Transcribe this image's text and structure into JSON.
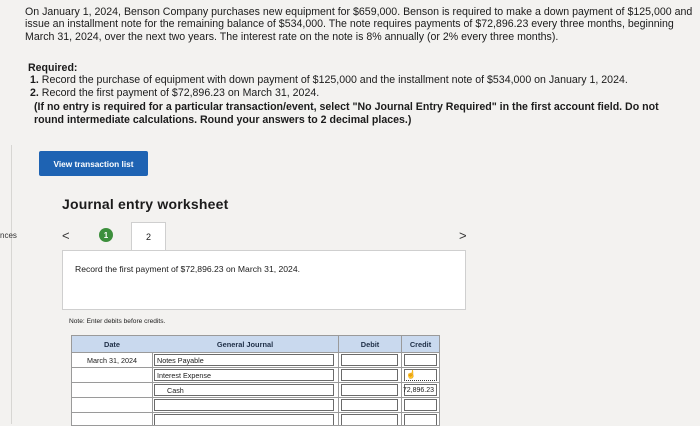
{
  "problem": {
    "text": "On January 1, 2024, Benson Company purchases new equipment for $659,000. Benson is required to make a down payment of $125,000 and issue an installment note for the remaining balance of $534,000. The note requires payments of $72,896.23 every three months, beginning March 31, 2024, over the next two years. The interest rate on the note is 8% annually (or 2% every three months)."
  },
  "required": {
    "title": "Required:",
    "items": [
      {
        "num": "1.",
        "text": "Record the purchase of equipment with down payment of $125,000 and the installment note of $534,000 on January 1, 2024."
      },
      {
        "num": "2.",
        "text": "Record the first payment of $72,896.23 on March 31, 2024."
      }
    ],
    "instructions": "(If no entry is required for a particular transaction/event, select \"No Journal Entry Required\" in the first account field. Do not round intermediate calculations. Round your answers to 2 decimal places.)"
  },
  "sidebar": {
    "tab_fragment": "nces"
  },
  "view_button": "View transaction list",
  "worksheet": {
    "title": "Journal entry worksheet",
    "nav_prev": "<",
    "nav_next": ">",
    "steps": [
      "1",
      "2"
    ],
    "description": "Record the first payment of $72,896.23 on March 31, 2024.",
    "note": "Note: Enter debits before credits."
  },
  "journal": {
    "headers": {
      "date": "Date",
      "general_journal": "General Journal",
      "debit": "Debit",
      "credit": "Credit"
    },
    "rows": [
      {
        "date": "March 31, 2024",
        "account": "Notes Payable",
        "debit": "",
        "credit": ""
      },
      {
        "date": "",
        "account": "Interest Expense",
        "debit": "",
        "credit": ""
      },
      {
        "date": "",
        "account": "Cash",
        "debit": "",
        "credit": "72,896.23"
      },
      {
        "date": "",
        "account": "",
        "debit": "",
        "credit": ""
      },
      {
        "date": "",
        "account": "",
        "debit": "",
        "credit": ""
      }
    ]
  },
  "colors": {
    "button": "#1e63b3",
    "step_complete": "#3c8f3c",
    "header_bg": "#c9d9ee"
  }
}
